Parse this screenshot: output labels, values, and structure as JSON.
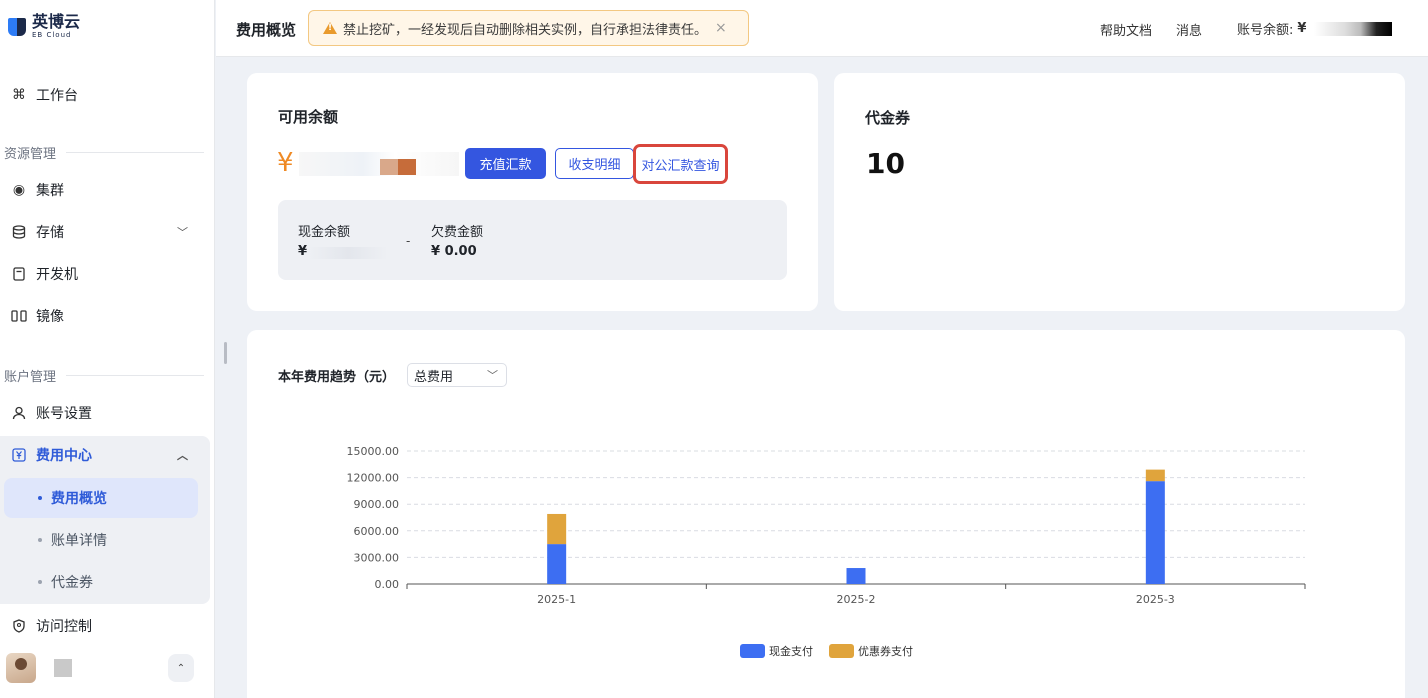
{
  "brand": {
    "name_cn": "英博云",
    "name_en": "EB Cloud"
  },
  "sidebar": {
    "workbench": "工作台",
    "section_resources": "资源管理",
    "cluster": "集群",
    "storage": "存储",
    "devbox": "开发机",
    "image": "镜像",
    "section_account": "账户管理",
    "account_settings": "账号设置",
    "billing_center": "费用中心",
    "billing_sub": [
      "费用概览",
      "账单详情",
      "代金券"
    ],
    "access_control": "访问控制"
  },
  "topbar": {
    "page_title": "费用概览",
    "notice": "禁止挖矿，一经发现后自动删除相关实例，自行承担法律责任。",
    "notice_close": "×",
    "help": "帮助文档",
    "messages": "消息",
    "balance_label": "账号余额:",
    "balance_symbol": "¥"
  },
  "balance_card": {
    "title": "可用余额",
    "currency": "¥",
    "recharge": "充值汇款",
    "details": "收支明细",
    "corp_query": "对公汇款查询",
    "cash_label": "现金余额",
    "cash_symbol": "¥",
    "separator": "-",
    "debt_label": "欠费金额",
    "debt_value": "¥ 0.00"
  },
  "voucher_card": {
    "title": "代金券",
    "value": "10"
  },
  "trend": {
    "title": "本年费用趋势（元）",
    "select_value": "总费用"
  },
  "chart_data": {
    "type": "bar",
    "stacked": true,
    "categories": [
      "2025-1",
      "2025-2",
      "2025-3"
    ],
    "series": [
      {
        "name": "现金支付",
        "color": "#3d6ef2",
        "values": [
          4500,
          1800,
          11600
        ]
      },
      {
        "name": "优惠券支付",
        "color": "#e0a43c",
        "values": [
          3400,
          0,
          1300
        ]
      }
    ],
    "yticks": [
      "0.00",
      "3000.00",
      "6000.00",
      "9000.00",
      "12000.00",
      "15000.00"
    ],
    "ylim": [
      0,
      15000
    ],
    "grid": true,
    "legend": "bottom"
  }
}
